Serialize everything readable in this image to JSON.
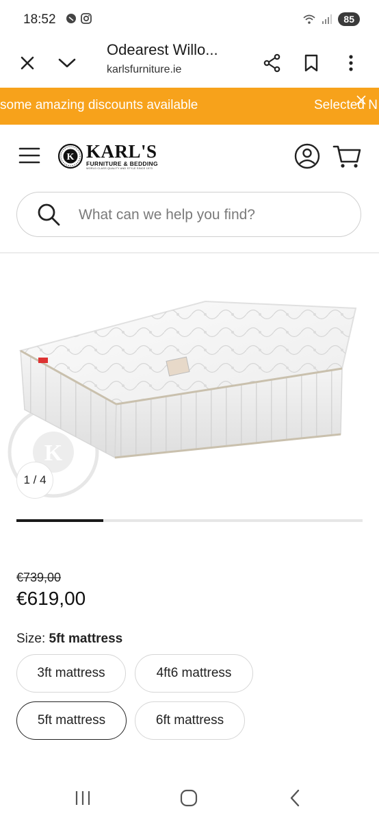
{
  "status_bar": {
    "time": "18:52",
    "battery": "85"
  },
  "browser": {
    "title": "Odearest Willo...",
    "url": "karlsfurniture.ie"
  },
  "promo": {
    "text_left": "some amazing discounts available",
    "text_right": "Selected N",
    "bg_color": "#f7a21b"
  },
  "header": {
    "logo_main": "KARL'S",
    "logo_sub": "FURNITURE & BEDDING",
    "logo_tag": "WORLD CLASS QUALITY AND STYLE SINCE 1973",
    "logo_badge_letter": "K"
  },
  "search": {
    "placeholder": "What can we help you find?"
  },
  "gallery": {
    "counter": "1 / 4",
    "current": 1,
    "total": 4
  },
  "product": {
    "old_price": "€739,00",
    "price": "€619,00"
  },
  "size": {
    "label": "Size:",
    "selected": "5ft mattress",
    "options": [
      "3ft mattress",
      "4ft6 mattress",
      "5ft mattress",
      "6ft mattress"
    ]
  },
  "icons": {
    "close": "close-icon",
    "chevron": "chevron-down-icon",
    "share": "share-icon",
    "bookmark": "bookmark-icon",
    "more": "more-vert-icon",
    "menu": "menu-icon",
    "account": "account-icon",
    "cart": "cart-icon",
    "search": "search-icon"
  }
}
